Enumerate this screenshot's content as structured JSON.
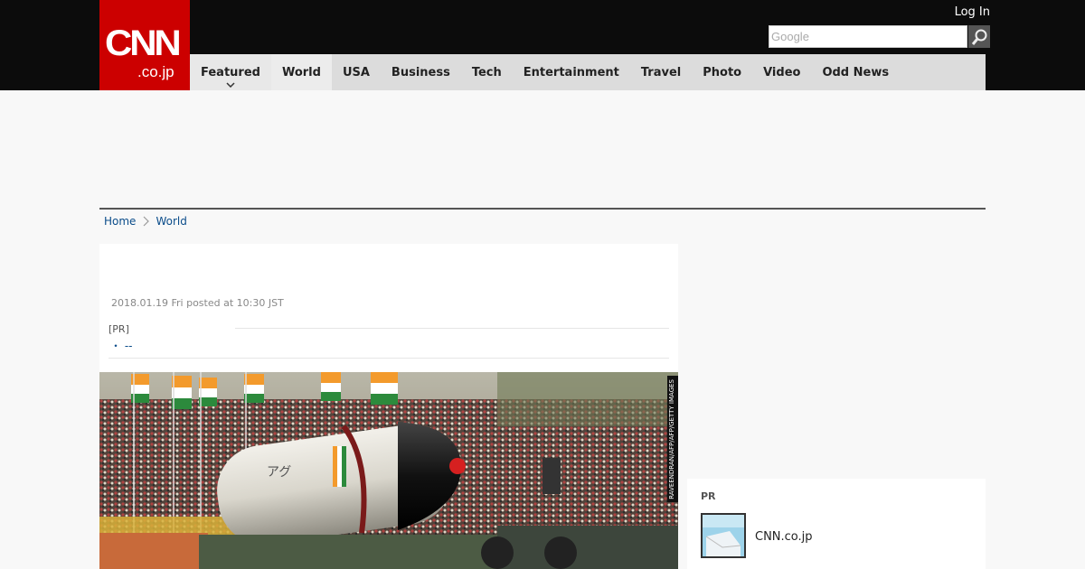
{
  "brand": {
    "logo_main": "CNN",
    "logo_sub": ".co.jp",
    "accent": "#cc0000"
  },
  "header": {
    "login_label": "Log In",
    "search_placeholder": "Google"
  },
  "nav": {
    "items": [
      {
        "label": "Featured"
      },
      {
        "label": "World"
      },
      {
        "label": "USA"
      },
      {
        "label": "Business"
      },
      {
        "label": "Tech"
      },
      {
        "label": "Entertainment"
      },
      {
        "label": "Travel"
      },
      {
        "label": "Photo"
      },
      {
        "label": "Video"
      },
      {
        "label": "Odd News"
      }
    ]
  },
  "breadcrumb": {
    "home": "Home",
    "section": "World"
  },
  "article": {
    "date": "2018.01.19 Fri posted at 10:30 JST",
    "pr_label": "[PR]",
    "pr_bullet": "・",
    "pr_link": "--",
    "photo_credit": "RAVEENDRAN/AFP/AFP/GETTY IMAGES"
  },
  "sidebar": {
    "pr_title": "PR",
    "pr_item_label": "CNN.co.jp"
  }
}
